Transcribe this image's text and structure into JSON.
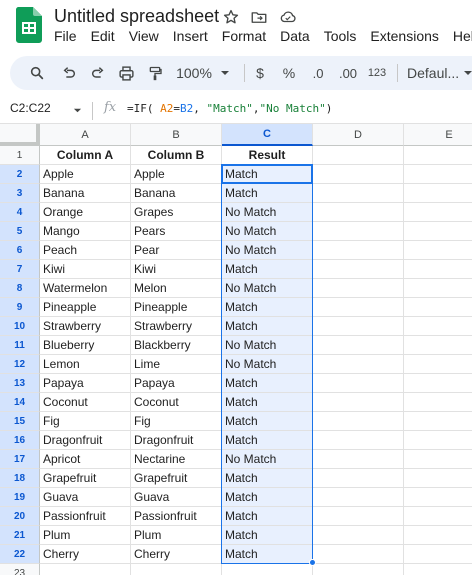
{
  "app": {
    "title": "Untitled spreadsheet",
    "menu": [
      "File",
      "Edit",
      "View",
      "Insert",
      "Format",
      "Data",
      "Tools",
      "Extensions",
      "Help"
    ]
  },
  "toolbar": {
    "zoom": "100%",
    "currency": "$",
    "percent": "%",
    "decrease_decimal": ".0",
    "increase_decimal": ".00",
    "number_format": "123",
    "font": "Defaul..."
  },
  "formula_bar": {
    "range": "C2:C22",
    "fx": "fx",
    "formula": {
      "prefix": "=IF( ",
      "ref1": "A2",
      "op": "=",
      "ref2": "B2",
      "mid": ", ",
      "str1": "\"Match\"",
      "comma": ",",
      "str2": "\"No Match\"",
      "suffix": ")"
    }
  },
  "sheet": {
    "columns": [
      "A",
      "B",
      "C",
      "D",
      "E"
    ],
    "selected_column": "C",
    "row_numbers": [
      "1",
      "2",
      "3",
      "4",
      "5",
      "6",
      "7",
      "8",
      "9",
      "10",
      "11",
      "12",
      "13",
      "14",
      "15",
      "16",
      "17",
      "18",
      "19",
      "20",
      "21",
      "22",
      "23"
    ],
    "header": [
      "Column A",
      "Column B",
      "Result"
    ],
    "rows": [
      [
        "Apple",
        "Apple",
        "Match"
      ],
      [
        "Banana",
        "Banana",
        "Match"
      ],
      [
        "Orange",
        "Grapes",
        "No Match"
      ],
      [
        "Mango",
        "Pears",
        "No Match"
      ],
      [
        "Peach",
        "Pear",
        "No Match"
      ],
      [
        "Kiwi",
        "Kiwi",
        "Match"
      ],
      [
        "Watermelon",
        "Melon",
        "No Match"
      ],
      [
        "Pineapple",
        "Pineapple",
        "Match"
      ],
      [
        "Strawberry",
        "Strawberry",
        "Match"
      ],
      [
        "Blueberry",
        "Blackberry",
        "No Match"
      ],
      [
        "Lemon",
        "Lime",
        "No Match"
      ],
      [
        "Papaya",
        "Papaya",
        "Match"
      ],
      [
        "Coconut",
        "Coconut",
        "Match"
      ],
      [
        "Fig",
        "Fig",
        "Match"
      ],
      [
        "Dragonfruit",
        "Dragonfruit",
        "Match"
      ],
      [
        "Apricot",
        "Nectarine",
        "No Match"
      ],
      [
        "Grapefruit",
        "Grapefruit",
        "Match"
      ],
      [
        "Guava",
        "Guava",
        "Match"
      ],
      [
        "Passionfruit",
        "Passionfruit",
        "Match"
      ],
      [
        "Plum",
        "Plum",
        "Match"
      ],
      [
        "Cherry",
        "Cherry",
        "Match"
      ]
    ]
  },
  "colors": {
    "brand_green": "#0f9d58",
    "selection_blue": "#1a73e8",
    "selection_fill": "#e8f0fe",
    "toolbar_bg": "#edf2fa"
  },
  "icons": [
    "sheets-logo",
    "star-icon",
    "move-to-folder-icon",
    "cloud-saved-icon",
    "search-icon",
    "undo-icon",
    "redo-icon",
    "print-icon",
    "paint-format-icon",
    "chevron-down-icon"
  ]
}
